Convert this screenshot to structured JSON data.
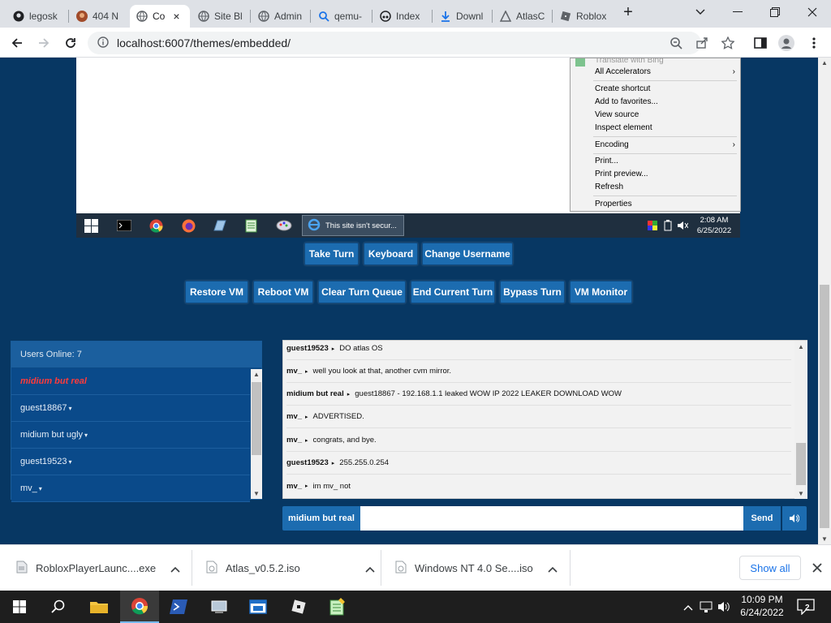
{
  "browser": {
    "tabs": [
      {
        "title": "legosk",
        "icon": "github-icon"
      },
      {
        "title": "404 N",
        "icon": "avatar-icon"
      },
      {
        "title": "Co",
        "icon": "globe-icon",
        "active": true
      },
      {
        "title": "Site Bl",
        "icon": "globe-icon"
      },
      {
        "title": "Admin",
        "icon": "globe-icon"
      },
      {
        "title": "qemu-",
        "icon": "search-icon"
      },
      {
        "title": "Index",
        "icon": "incognito-icon"
      },
      {
        "title": "Downl",
        "icon": "download-icon"
      },
      {
        "title": "AtlasC",
        "icon": "triangle-icon"
      },
      {
        "title": "Roblox",
        "icon": "roblox-icon"
      }
    ],
    "close_tab_glyph": "×",
    "new_tab_glyph": "+",
    "url": "localhost:6007/themes/embedded/"
  },
  "vm": {
    "context_menu": {
      "items": [
        {
          "label": "Translate with Bing",
          "disabled": true
        },
        {
          "label": "All Accelerators",
          "submenu": true
        },
        {
          "label": "Create shortcut"
        },
        {
          "label": "Add to favorites..."
        },
        {
          "label": "View source"
        },
        {
          "label": "Inspect element"
        },
        {
          "label": "Encoding",
          "submenu": true
        },
        {
          "label": "Print..."
        },
        {
          "label": "Print preview..."
        },
        {
          "label": "Refresh"
        },
        {
          "label": "Properties"
        }
      ]
    },
    "taskbar": {
      "window_title": "This site isn't secur...",
      "time": "2:08 AM",
      "date": "6/25/2022"
    }
  },
  "controls": {
    "row1": [
      "Take Turn",
      "Keyboard",
      "Change Username"
    ],
    "row2": [
      "Restore VM",
      "Reboot VM",
      "Clear Turn Queue",
      "End Current Turn",
      "Bypass Turn",
      "VM Monitor"
    ]
  },
  "users": {
    "header": "Users Online: 7",
    "list": [
      {
        "name": "midium but real",
        "self": true
      },
      {
        "name": "guest18867"
      },
      {
        "name": "midium but ugly"
      },
      {
        "name": "guest19523"
      },
      {
        "name": "mv_"
      }
    ]
  },
  "chat": {
    "messages": [
      {
        "user": "guest19523",
        "text": "DO atlas OS"
      },
      {
        "user": "mv_",
        "text": "well you look at that, another cvm mirror."
      },
      {
        "user": "midium but real",
        "text": "guest18867 - 192.168.1.1 leaked WOW IP 2022 LEAKER DOWNLOAD WOW"
      },
      {
        "user": "mv_",
        "text": "ADVERTISED."
      },
      {
        "user": "mv_",
        "text": "congrats, and bye."
      },
      {
        "user": "guest19523",
        "text": "255.255.0.254"
      },
      {
        "user": "mv_",
        "text": "im mv_ not"
      }
    ],
    "username_label": "midium but real",
    "input_value": "",
    "send_label": "Send"
  },
  "downloads": {
    "items": [
      {
        "name": "RobloxPlayerLaunc....exe"
      },
      {
        "name": "Atlas_v0.5.2.iso"
      },
      {
        "name": "Windows NT 4.0 Se....iso"
      }
    ],
    "show_all": "Show all"
  },
  "taskbar": {
    "time": "10:09 PM",
    "date": "6/24/2022",
    "notification_count": "2"
  },
  "colors": {
    "page_bg": "#073763",
    "button": "#1c6cb0",
    "self_user": "#ff3b3b"
  }
}
